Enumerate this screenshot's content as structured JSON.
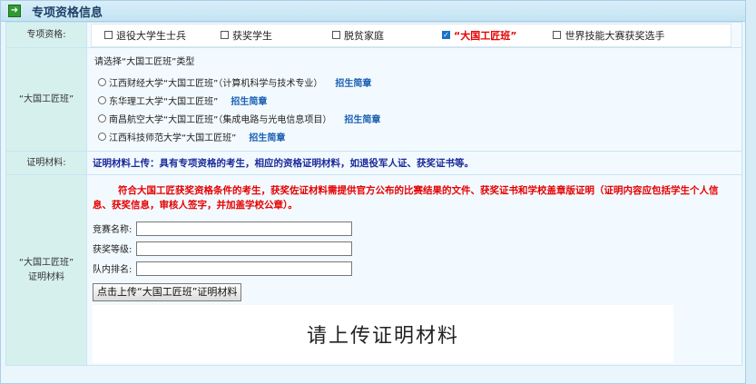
{
  "panel": {
    "title": "专项资格信息"
  },
  "qualification": {
    "label": "专项资格:",
    "options": [
      {
        "label": "退役大学生士兵",
        "checked": false
      },
      {
        "label": "获奖学生",
        "checked": false
      },
      {
        "label": "脱贫家庭",
        "checked": false
      },
      {
        "label": "“大国工匠班”",
        "checked": true
      },
      {
        "label": "世界技能大赛获奖选手",
        "checked": false
      }
    ]
  },
  "type_section": {
    "label": "“大国工匠班”",
    "prompt": "请选择“大国工匠班”类型",
    "options": [
      {
        "label": "江西财经大学“大国工匠班”（计算机科学与技术专业）",
        "link": "招生简章"
      },
      {
        "label": "东华理工大学“大国工匠班”",
        "link": "招生简章"
      },
      {
        "label": "南昌航空大学“大国工匠班”（集成电路与光电信息项目）",
        "link": "招生简章"
      },
      {
        "label": "江西科技师范大学“大国工匠班”",
        "link": "招生简章"
      }
    ]
  },
  "proof": {
    "label": "证明材料:",
    "text": "证明材料上传：具有专项资格的考生，相应的资格证明材料，如退役军人证、获奖证书等。"
  },
  "upload": {
    "label_line1": "“大国工匠班”",
    "label_line2": "证明材料",
    "notice": "符合大国工匠获奖资格条件的考生，获奖佐证材料需提供官方公布的比赛结果的文件、获奖证书和学校盖章版证明（证明内容应包括学生个人信息、获奖信息，审核人签字，并加盖学校公章）。",
    "fields": [
      {
        "label": "竞赛名称:",
        "value": ""
      },
      {
        "label": "获奖等级:",
        "value": ""
      },
      {
        "label": "队内排名:",
        "value": ""
      }
    ],
    "button_label": "点击上传“大国工匠班”证明材料",
    "preview_text": "请上传证明材料"
  }
}
